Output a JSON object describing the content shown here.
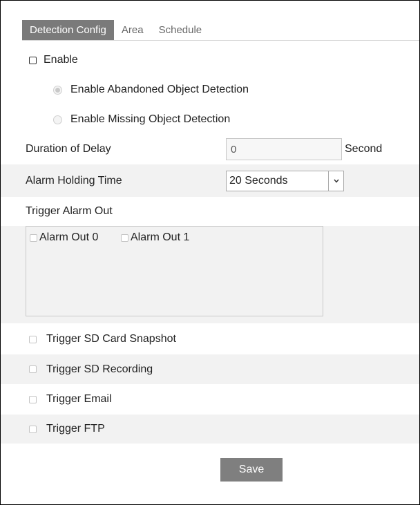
{
  "tabs": [
    {
      "label": "Detection Config",
      "active": true
    },
    {
      "label": "Area",
      "active": false
    },
    {
      "label": "Schedule",
      "active": false
    }
  ],
  "enable": {
    "label": "Enable",
    "checked": false
  },
  "radios": [
    {
      "label": "Enable Abandoned Object Detection",
      "checked": true
    },
    {
      "label": "Enable Missing Object Detection",
      "checked": false
    }
  ],
  "delay": {
    "label": "Duration of Delay",
    "value": "0",
    "unit": "Second"
  },
  "holding": {
    "label": "Alarm Holding Time",
    "selected": "20 Seconds"
  },
  "trigger_alarm": {
    "label": "Trigger Alarm Out",
    "outputs": [
      {
        "label": "Alarm Out 0",
        "checked": false
      },
      {
        "label": "Alarm Out 1",
        "checked": false
      }
    ]
  },
  "triggers": [
    {
      "label": "Trigger SD Card Snapshot",
      "checked": false
    },
    {
      "label": "Trigger SD Recording",
      "checked": false
    },
    {
      "label": "Trigger Email",
      "checked": false
    },
    {
      "label": "Trigger FTP",
      "checked": false
    }
  ],
  "save_label": "Save",
  "colors": {
    "active_tab": "#7a7a7a",
    "shaded_row": "#f2f2f2",
    "save_button": "#7f7f7f"
  }
}
